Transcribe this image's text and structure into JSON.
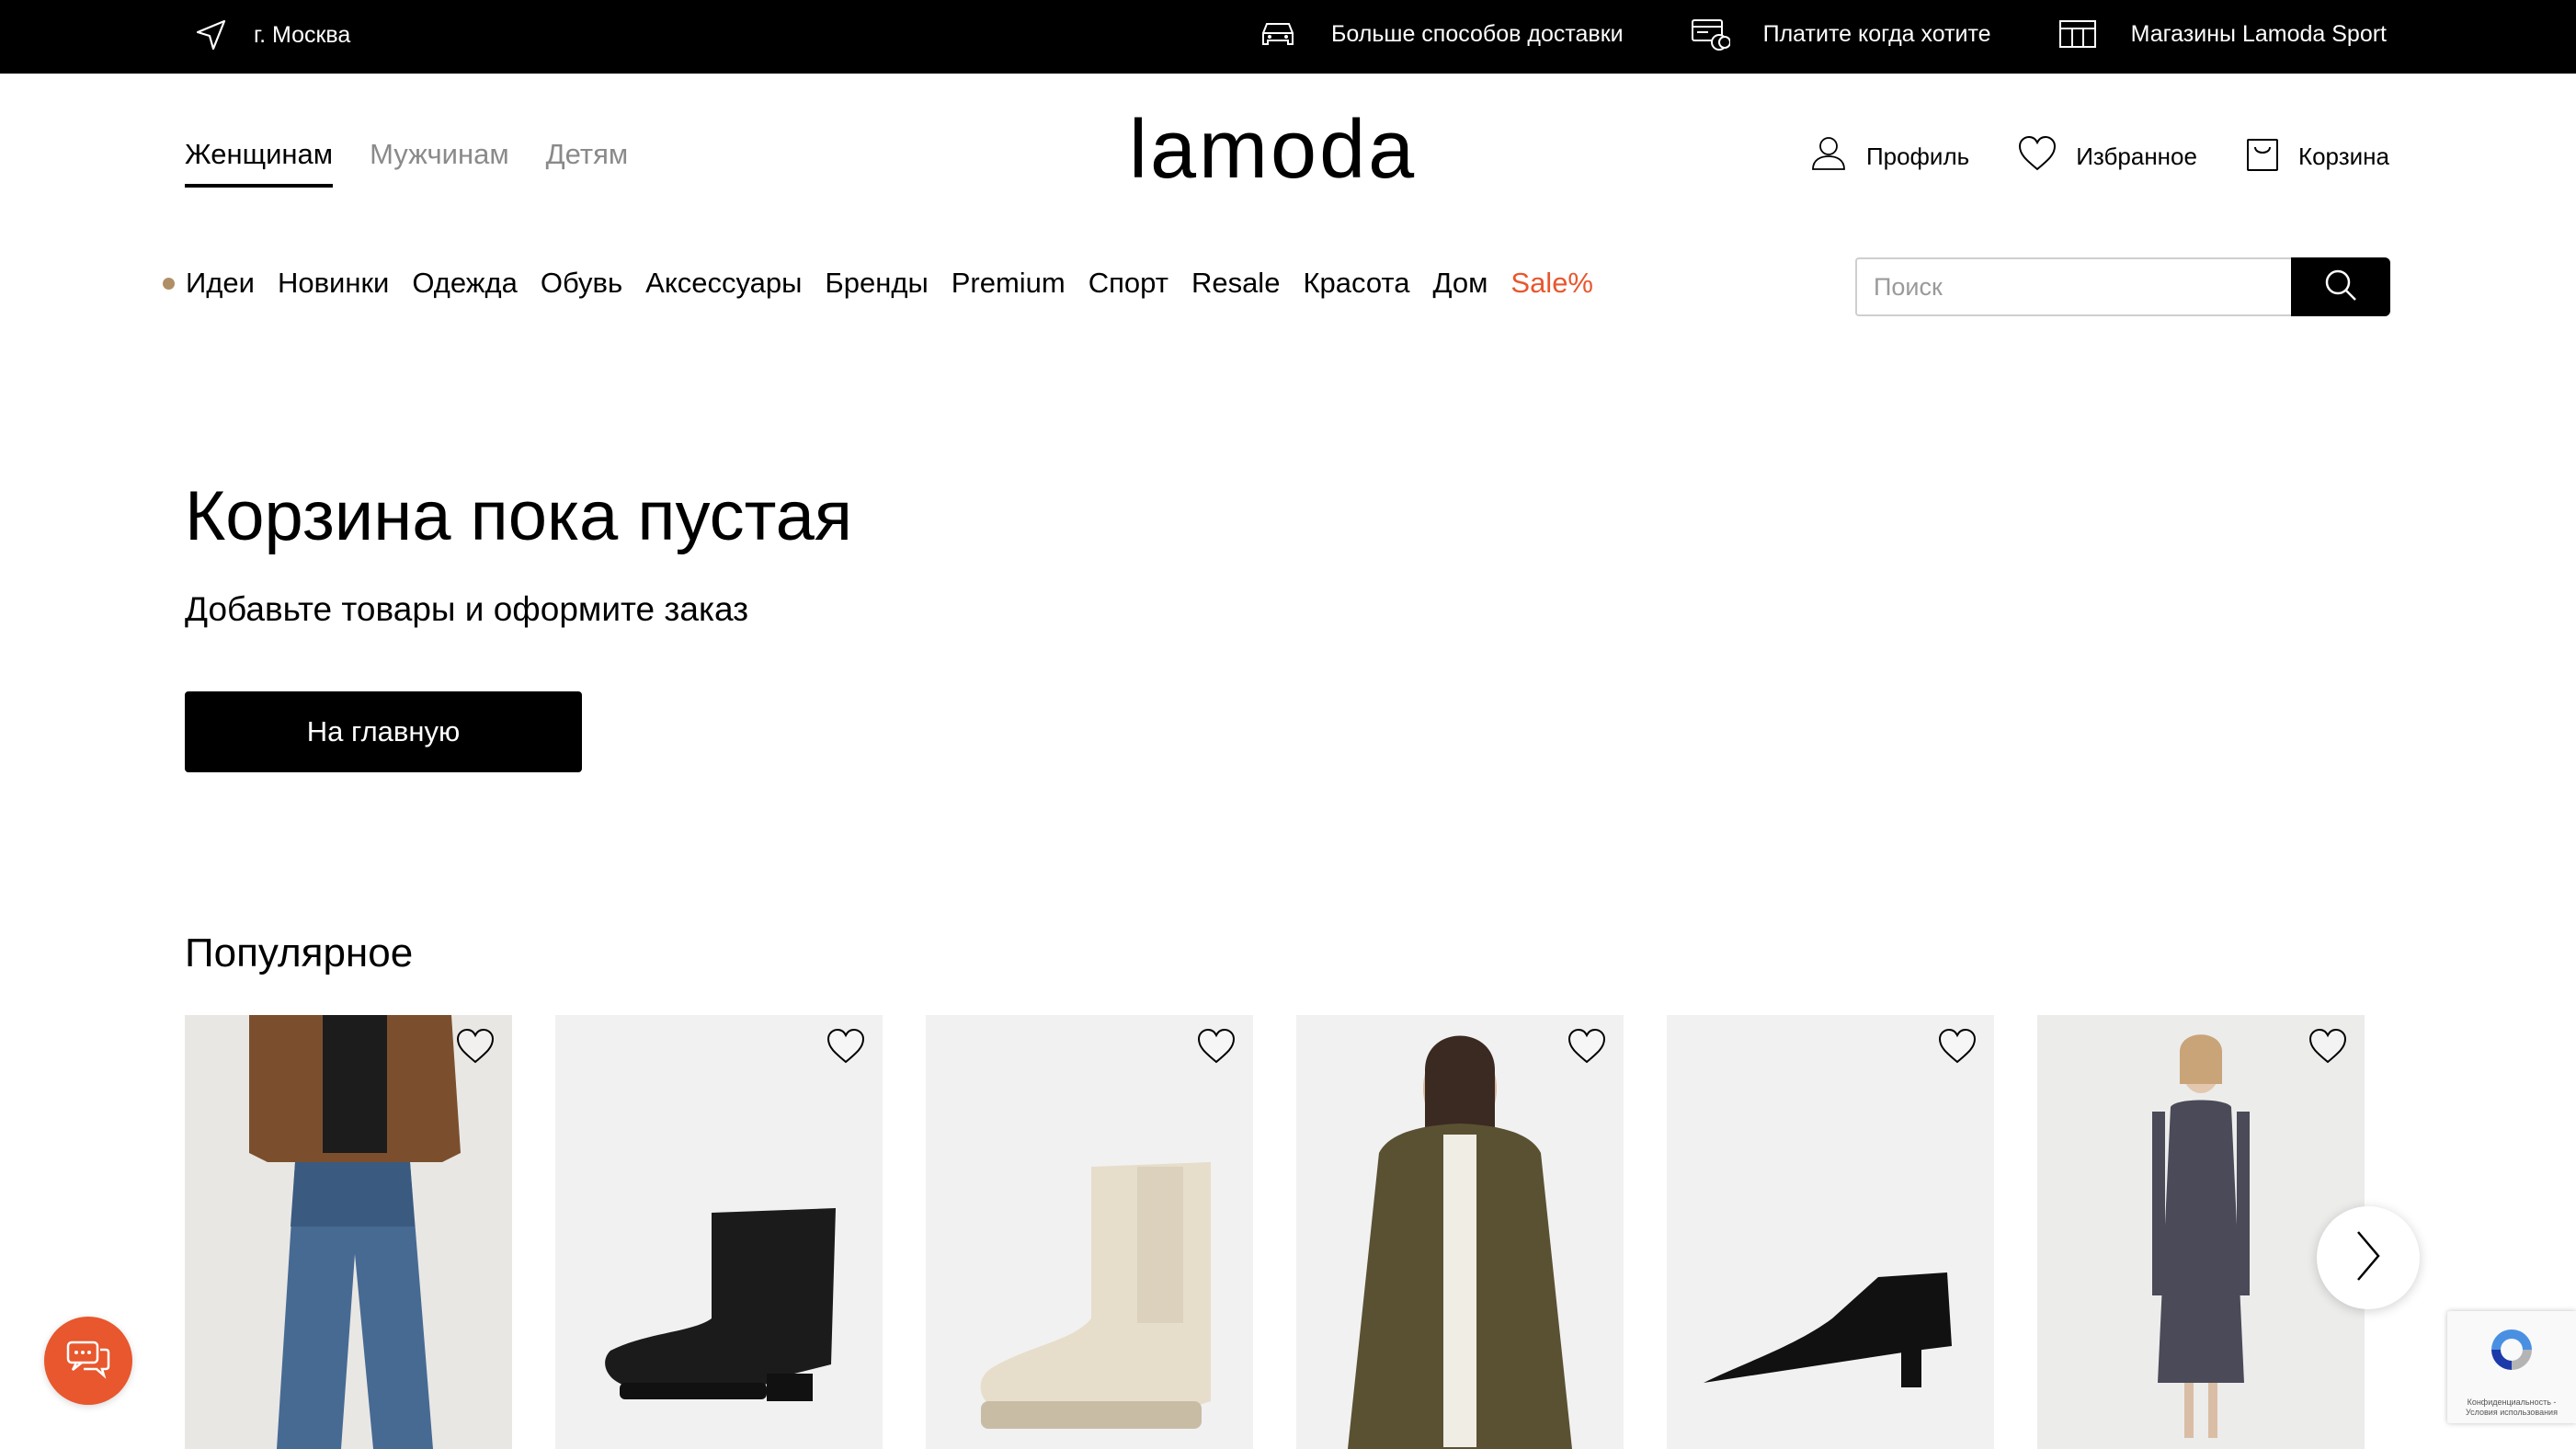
{
  "topbar": {
    "city": "г. Москва",
    "delivery": "Больше способов доставки",
    "pay": "Платите когда хотите",
    "stores": "Магазины Lamoda Sport"
  },
  "header": {
    "gender_tabs": [
      "Женщинам",
      "Мужчинам",
      "Детям"
    ],
    "active_gender": "Женщинам",
    "logo": "lamoda",
    "profile": "Профиль",
    "favorites": "Избранное",
    "cart": "Корзина"
  },
  "catnav": {
    "items": [
      "Идеи",
      "Новинки",
      "Одежда",
      "Обувь",
      "Аксессуары",
      "Бренды",
      "Premium",
      "Спорт",
      "Resale",
      "Красота",
      "Дом",
      "Sale%"
    ],
    "sale_color": "#e8572d",
    "dot_color": "#b08f67"
  },
  "search": {
    "placeholder": "Поиск",
    "value": ""
  },
  "empty_cart": {
    "title": "Корзина пока пустая",
    "subtitle": "Добавьте товары и оформите заказ",
    "button": "На главную"
  },
  "popular": {
    "title": "Популярное",
    "products": [
      {
        "type": "jeans-look"
      },
      {
        "type": "black-ankle-boot"
      },
      {
        "type": "beige-chelsea-boot"
      },
      {
        "type": "olive-faux-fur-coat"
      },
      {
        "type": "black-pointed-bootie"
      },
      {
        "type": "grey-knit-dress"
      }
    ]
  },
  "recaptcha": {
    "text": "Конфиденциальность - Условия использования"
  },
  "colors": {
    "accent": "#e8572d",
    "topbar_bg": "#000000"
  }
}
